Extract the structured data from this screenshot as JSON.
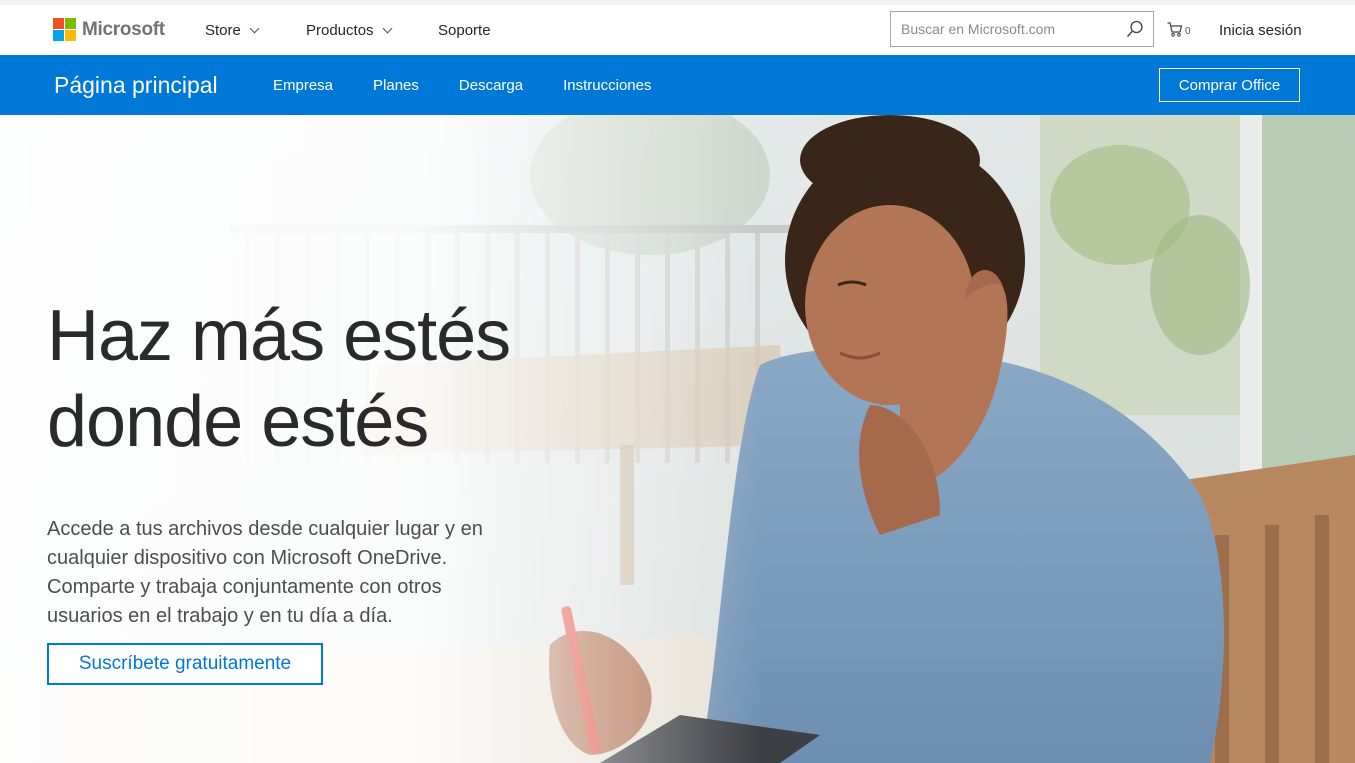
{
  "header": {
    "brand": "Microsoft",
    "nav": [
      {
        "label": "Store",
        "has_dropdown": true
      },
      {
        "label": "Productos",
        "has_dropdown": true
      },
      {
        "label": "Soporte",
        "has_dropdown": false
      }
    ],
    "search": {
      "placeholder": "Buscar en Microsoft.com",
      "icon": "search-icon"
    },
    "cart": {
      "icon": "cart-icon",
      "count": "0"
    },
    "signin_label": "Inicia sesión"
  },
  "subnav": {
    "title": "Página principal",
    "links": [
      "Empresa",
      "Planes",
      "Descarga",
      "Instrucciones"
    ],
    "buy_label": "Comprar Office",
    "background_color": "#0078d7"
  },
  "hero": {
    "headline_line1": "Haz más estés",
    "headline_line2": "donde estés",
    "description": "Accede a tus archivos desde cualquier lugar y en cualquier dispositivo con Microsoft OneDrive. Comparte y trabaja conjuntamente con otros usuarios en el trabajo y en tu día a día.",
    "cta_label": "Suscríbete gratuitamente",
    "accent_color": "#0078d7"
  }
}
